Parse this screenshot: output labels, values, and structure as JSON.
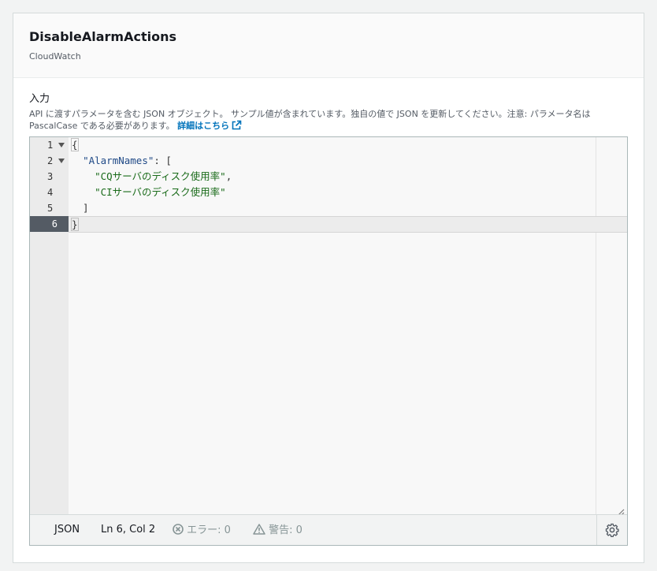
{
  "header": {
    "title": "DisableAlarmActions",
    "subtitle": "CloudWatch"
  },
  "field": {
    "label": "入力",
    "description": "API に渡すパラメータを含む JSON オブジェクト。 サンプル値が含まれています。独自の値で JSON を更新してください。注意: パラメータ名は PascalCase である必要があります。",
    "link_text": "詳細はこちら"
  },
  "editor": {
    "lines": [
      {
        "num": "1",
        "foldable": true,
        "text": "{"
      },
      {
        "num": "2",
        "foldable": true,
        "text": "  \"AlarmNames\": ["
      },
      {
        "num": "3",
        "foldable": false,
        "text": "    \"CQサーバのディスク使用率\","
      },
      {
        "num": "4",
        "foldable": false,
        "text": "    \"CIサーバのディスク使用率\""
      },
      {
        "num": "5",
        "foldable": false,
        "text": "  ]"
      },
      {
        "num": "6",
        "foldable": false,
        "text": "}"
      }
    ],
    "line_nums": {
      "l1": "1",
      "l2": "2",
      "l3": "3",
      "l4": "4",
      "l5": "5",
      "l6": "6"
    },
    "tokens": {
      "l1_brace": "{",
      "l2_indent": "  ",
      "l2_key": "\"AlarmNames\"",
      "l2_rest": ": [",
      "l3_indent": "    ",
      "l3_str": "\"CQサーバのディスク使用率\"",
      "l3_comma": ",",
      "l4_indent": "    ",
      "l4_str": "\"CIサーバのディスク使用率\"",
      "l5_text": "  ]",
      "l6_brace": "}"
    }
  },
  "status_bar": {
    "mode": "JSON",
    "position": "Ln 6, Col 2",
    "errors": "エラー: 0",
    "warnings": "警告: 0"
  },
  "colors": {
    "link": "#0073bb",
    "active_line_number_bg": "#545b64",
    "string": "#1a6b1a",
    "key": "#204a87"
  }
}
